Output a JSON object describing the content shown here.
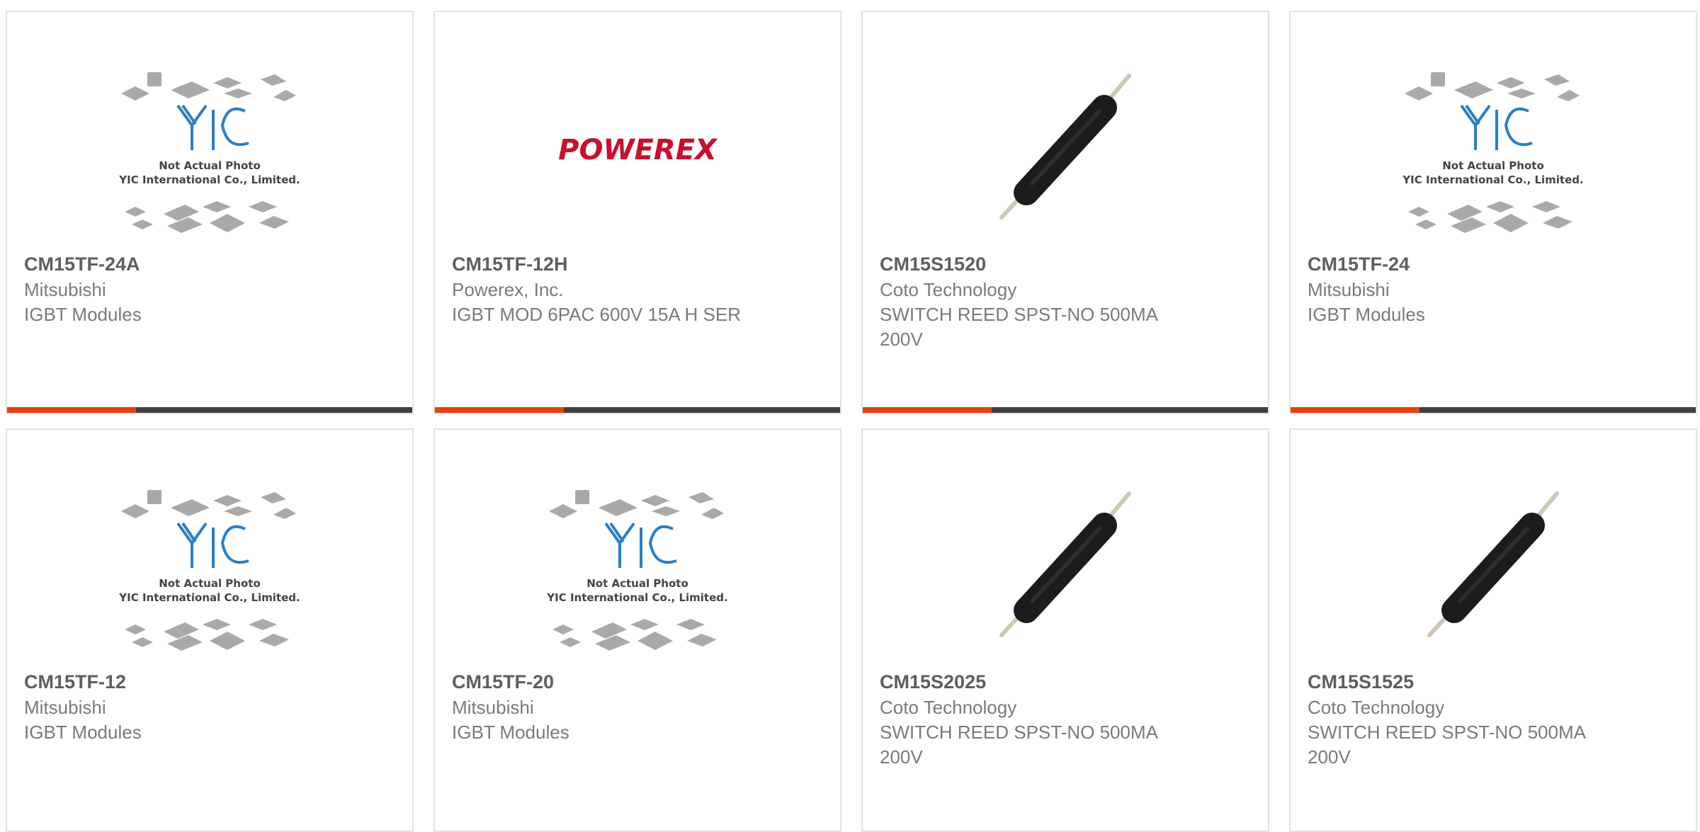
{
  "products": [
    {
      "image": "yic-placeholder",
      "placeholder_caption_1": "Not Actual Photo",
      "placeholder_caption_2": "YIC International Co., Limited.",
      "part_number": "CM15TF-24A",
      "manufacturer": "Mitsubishi",
      "description": "IGBT Modules"
    },
    {
      "image": "powerex-logo",
      "logo_text": "POWEREX",
      "part_number": "CM15TF-12H",
      "manufacturer": "Powerex, Inc.",
      "description": "IGBT MOD 6PAC 600V 15A H SER"
    },
    {
      "image": "reed-switch",
      "part_number": "CM15S1520",
      "manufacturer": "Coto Technology",
      "description": "SWITCH REED SPST-NO 500MA 200V"
    },
    {
      "image": "yic-placeholder",
      "placeholder_caption_1": "Not Actual Photo",
      "placeholder_caption_2": "YIC International Co., Limited.",
      "part_number": "CM15TF-24",
      "manufacturer": "Mitsubishi",
      "description": "IGBT Modules"
    },
    {
      "image": "yic-placeholder",
      "placeholder_caption_1": "Not Actual Photo",
      "placeholder_caption_2": "YIC International Co., Limited.",
      "part_number": "CM15TF-12",
      "manufacturer": "Mitsubishi",
      "description": "IGBT Modules"
    },
    {
      "image": "yic-placeholder",
      "placeholder_caption_1": "Not Actual Photo",
      "placeholder_caption_2": "YIC International Co., Limited.",
      "part_number": "CM15TF-20",
      "manufacturer": "Mitsubishi",
      "description": "IGBT Modules"
    },
    {
      "image": "reed-switch",
      "part_number": "CM15S2025",
      "manufacturer": "Coto Technology",
      "description": "SWITCH REED SPST-NO 500MA 200V"
    },
    {
      "image": "reed-switch",
      "part_number": "CM15S1525",
      "manufacturer": "Coto Technology",
      "description": "SWITCH REED SPST-NO 500MA 200V"
    }
  ],
  "colors": {
    "accent": "#e4410e",
    "bar": "#3f3f3f",
    "yic_blue": "#2a7fc1",
    "powerex_red": "#c8102e"
  }
}
